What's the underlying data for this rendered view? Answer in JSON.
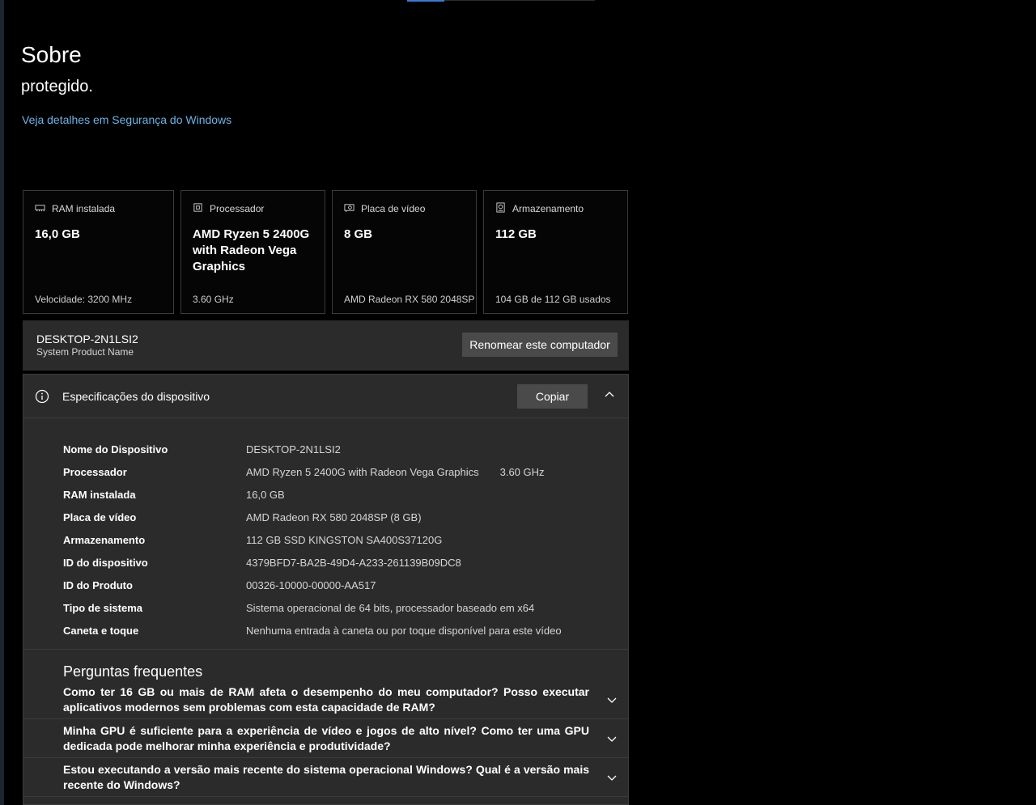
{
  "page": {
    "title": "Sobre",
    "protected_text": "protegido.",
    "security_link": "Veja detalhes em Segurança do Windows"
  },
  "cards": [
    {
      "label": "RAM instalada",
      "value": "16,0 GB",
      "sub": "Velocidade: 3200 MHz",
      "icon": "ram-icon"
    },
    {
      "label": "Processador",
      "value": "AMD Ryzen 5 2400G with Radeon Vega Graphics",
      "sub": "3.60 GHz",
      "icon": "processor-icon"
    },
    {
      "label": "Placa de vídeo",
      "value": "8 GB",
      "sub": "AMD Radeon RX 580 2048SP",
      "icon": "gpu-icon"
    },
    {
      "label": "Armazenamento",
      "value": "112 GB",
      "sub": "104 GB de 112 GB usados",
      "icon": "storage-icon"
    }
  ],
  "device": {
    "name": "DESKTOP-2N1LSI2",
    "model": "System Product Name",
    "rename_label": "Renomear este computador"
  },
  "specs": {
    "title": "Especificações do dispositivo",
    "copy_label": "Copiar",
    "rows": [
      {
        "label": "Nome do Dispositivo",
        "value": "DESKTOP-2N1LSI2"
      },
      {
        "label": "Processador",
        "value": "AMD Ryzen 5 2400G with Radeon Vega Graphics",
        "extra": "3.60 GHz"
      },
      {
        "label": "RAM instalada",
        "value": "16,0 GB"
      },
      {
        "label": "Placa de vídeo",
        "value": "AMD Radeon RX 580 2048SP (8 GB)"
      },
      {
        "label": "Armazenamento",
        "value": "112 GB SSD KINGSTON SA400S37120G"
      },
      {
        "label": "ID do dispositivo",
        "value": "4379BFD7-BA2B-49D4-A233-261139B09DC8"
      },
      {
        "label": "ID do Produto",
        "value": "00326-10000-00000-AA517"
      },
      {
        "label": "Tipo de sistema",
        "value": "Sistema operacional de 64 bits, processador baseado em x64"
      },
      {
        "label": "Caneta e toque",
        "value": "Nenhuma entrada à caneta ou por toque disponível para este vídeo"
      }
    ]
  },
  "faq": {
    "title": "Perguntas frequentes",
    "items": [
      {
        "question": "Como ter 16 GB ou mais de RAM afeta o desempenho do meu computador? Posso executar aplicativos modernos sem problemas com esta capacidade de RAM?"
      },
      {
        "question": "Minha GPU é suficiente para a experiência de vídeo e jogos de alto nível? Como ter uma GPU dedicada pode melhorar minha experiência e produtividade?"
      },
      {
        "question": "Estou executando a versão mais recente do sistema operacional Windows? Qual é a versão mais recente do Windows?"
      }
    ]
  },
  "colors": {
    "background": "#000000",
    "panel": "#2b2b2b",
    "link": "#6cb4e8",
    "button": "#4a4a4a"
  }
}
